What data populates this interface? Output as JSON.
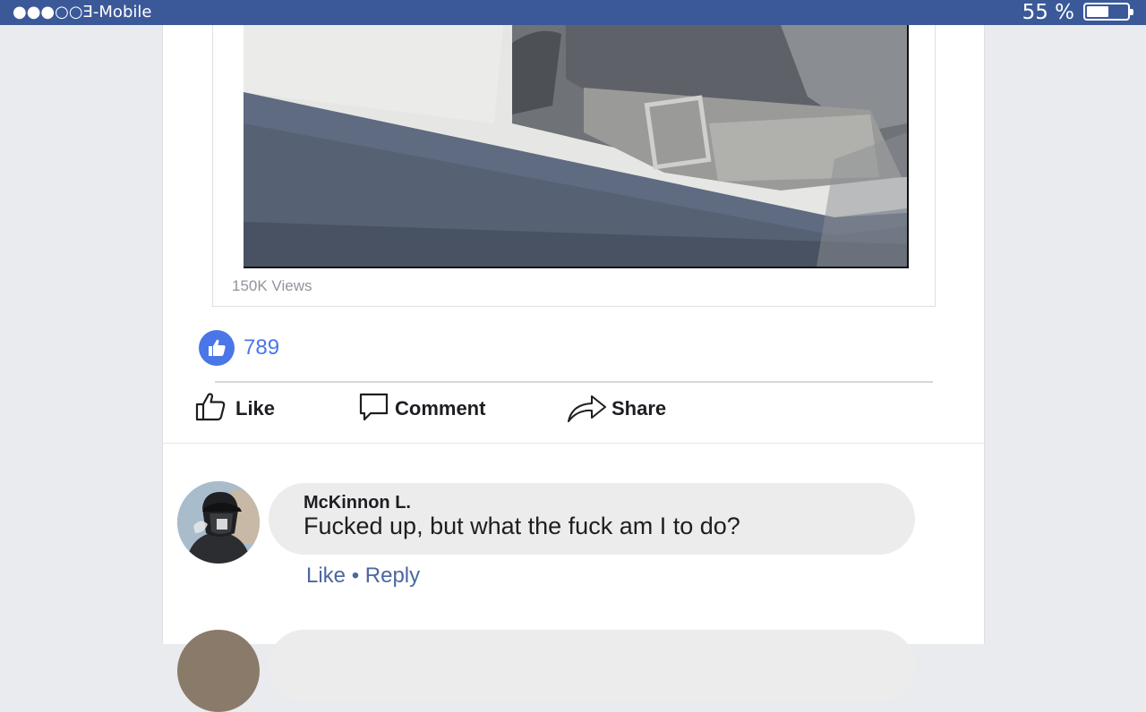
{
  "status_bar": {
    "carrier": "●●●○○Ǝ-Mobile",
    "battery_percent": "55 %",
    "battery_level": 0.55,
    "background_color": "#3b5998"
  },
  "post": {
    "video": {
      "views": "150K Views"
    },
    "reactions": {
      "icon": "thumbs-up-icon",
      "count": "789",
      "accent_color": "#4a76e8"
    },
    "actions": {
      "like": {
        "label": "Like",
        "icon": "thumbs-up-outline-icon"
      },
      "comment": {
        "label": "Comment",
        "icon": "speech-bubble-icon"
      },
      "share": {
        "label": "Share",
        "icon": "share-arrow-icon"
      }
    }
  },
  "comments": [
    {
      "author": "McKinnon L.",
      "text": "Fucked up, but what the fuck am I to do?",
      "like_label": "Like",
      "separator": " • ",
      "reply_label": "Reply",
      "link_color": "#4b67a1"
    }
  ]
}
